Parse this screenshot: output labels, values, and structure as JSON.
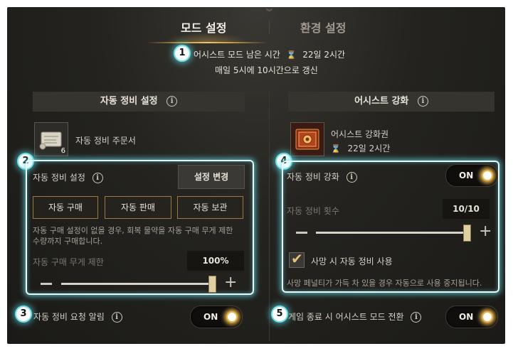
{
  "tabs": {
    "mode_settings": "모드 설정",
    "env_settings": "환경 설정"
  },
  "badges": [
    "1",
    "2",
    "3",
    "4",
    "5"
  ],
  "assist_time": {
    "label": "어시스트 모드 남은 시간",
    "hourglass": "⌛",
    "value": "22일 2시간",
    "refresh": "매일 5시에 10시간으로 갱신"
  },
  "auto_repair": {
    "header": "자동 정비 설정",
    "item_name": "자동 정비 주문서",
    "item_count": "6",
    "setting_label": "자동 정비 설정",
    "change_button": "설정 변경",
    "buy_button": "자동 구매",
    "sell_button": "자동 판매",
    "store_button": "자동 보관",
    "description": "자동 구매 설정이 없을 경우, 회복 물약을 자동 구매 무게 제한\n수량까지 구매합니다.",
    "weight_label": "자동 구매 무게 제한",
    "weight_value": "100%",
    "weight_level": 1.0
  },
  "repair_alert": {
    "label": "자동 정비 요청 알림",
    "toggle": "ON"
  },
  "assist_boost": {
    "header": "어시스트 강화",
    "item_name": "어시스트 강화권",
    "item_time": "22일 2시간",
    "boost_label": "자동 정비 강화",
    "boost_toggle": "ON",
    "count_label": "자동 정비 횟수",
    "count_value": "10/10",
    "count_level": 1.0,
    "death_label": "사망 시 자동 정비 사용",
    "death_checked": true,
    "death_note": "사망 페널티가 가득 차 있을 경우 자동으로 사용 중지됩니다."
  },
  "game_exit": {
    "label": "게임 종료 시 어시스트 모드 전환",
    "toggle": "ON"
  },
  "icons": {
    "info": "i",
    "minus": "−",
    "plus": "+",
    "check": "✔",
    "top_mark": "︾"
  }
}
